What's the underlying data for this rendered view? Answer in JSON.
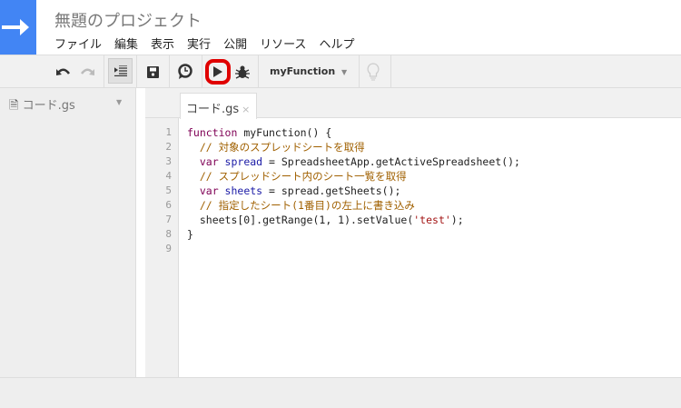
{
  "header": {
    "title": "無題のプロジェクト",
    "menu": [
      "ファイル",
      "編集",
      "表示",
      "実行",
      "公開",
      "リソース",
      "ヘルプ"
    ]
  },
  "toolbar": {
    "function_select": "myFunction"
  },
  "sidebar": {
    "file": "コード.gs"
  },
  "tab": {
    "label": "コード.gs",
    "close": "×"
  },
  "editor": {
    "line_numbers": [
      "1",
      "2",
      "3",
      "4",
      "5",
      "6",
      "7",
      "8",
      "9"
    ],
    "lines": [
      [
        [
          "kw",
          "function "
        ],
        [
          "pl",
          "myFunction() {"
        ]
      ],
      [
        [
          "cm",
          "  // 対象のスプレッドシートを取得"
        ]
      ],
      [
        [
          "kw",
          "  var "
        ],
        [
          "var",
          "spread"
        ],
        [
          "pl",
          " = SpreadsheetApp.getActiveSpreadsheet();"
        ]
      ],
      [
        [
          "cm",
          "  // スプレッドシート内のシート一覧を取得"
        ]
      ],
      [
        [
          "kw",
          "  var "
        ],
        [
          "var",
          "sheets"
        ],
        [
          "pl",
          " = spread.getSheets();"
        ]
      ],
      [
        [
          "cm",
          "  // 指定したシート(1番目)の左上に書き込み"
        ]
      ],
      [
        [
          "pl",
          "  sheets[0].getRange(1, 1).setValue("
        ],
        [
          "st",
          "'test'"
        ],
        [
          "pl",
          ");"
        ]
      ],
      [
        [
          "pl",
          "}"
        ]
      ],
      []
    ]
  },
  "colors": {
    "brand": "#4285f4",
    "highlight": "#e00000"
  }
}
